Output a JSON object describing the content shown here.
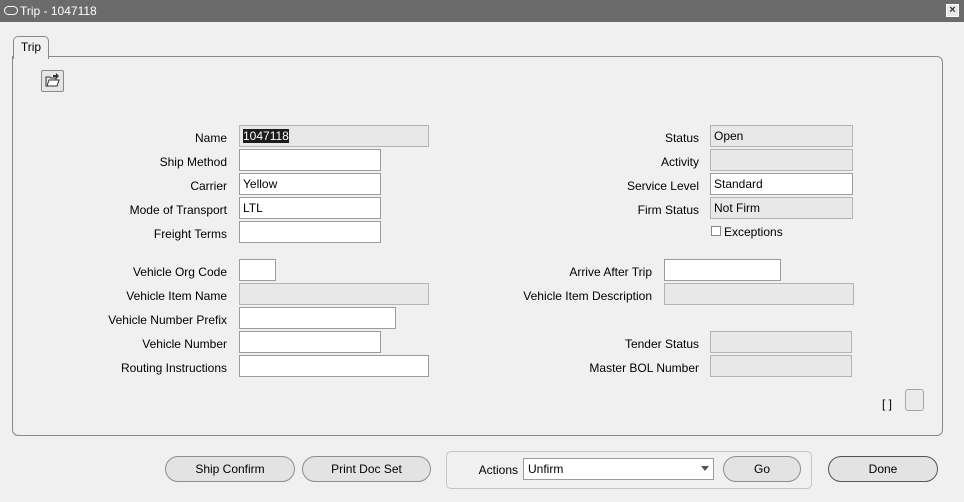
{
  "window": {
    "title": "Trip - 1047118",
    "close_glyph": "×"
  },
  "tab": {
    "label": "Trip"
  },
  "toolbar": {
    "icon": "folder-open-icon"
  },
  "fields": {
    "name": {
      "label": "Name",
      "value": "1047118"
    },
    "ship_method": {
      "label": "Ship Method",
      "value": ""
    },
    "carrier": {
      "label": "Carrier",
      "value": "Yellow"
    },
    "mode_of_transport": {
      "label": "Mode of Transport",
      "value": "LTL"
    },
    "freight_terms": {
      "label": "Freight Terms",
      "value": ""
    },
    "status": {
      "label": "Status",
      "value": "Open"
    },
    "activity": {
      "label": "Activity",
      "value": ""
    },
    "service_level": {
      "label": "Service Level",
      "value": "Standard"
    },
    "firm_status": {
      "label": "Firm Status",
      "value": "Not Firm"
    },
    "exceptions": {
      "label": "Exceptions",
      "checked": false
    },
    "vehicle_org_code": {
      "label": "Vehicle Org Code",
      "value": ""
    },
    "vehicle_item_name": {
      "label": "Vehicle Item Name",
      "value": ""
    },
    "vehicle_number_prefix": {
      "label": "Vehicle Number Prefix",
      "value": ""
    },
    "vehicle_number": {
      "label": "Vehicle Number",
      "value": ""
    },
    "routing_instructions": {
      "label": "Routing Instructions",
      "value": ""
    },
    "arrive_after_trip": {
      "label": "Arrive After Trip",
      "value": ""
    },
    "vehicle_item_description": {
      "label": "Vehicle Item Description",
      "value": ""
    },
    "tender_status": {
      "label": "Tender Status",
      "value": ""
    },
    "master_bol_number": {
      "label": "Master BOL Number",
      "value": ""
    }
  },
  "flex_field": {
    "label": "[ ]"
  },
  "footer": {
    "ship_confirm": "Ship Confirm",
    "print_doc_set": "Print Doc Set",
    "actions_label": "Actions",
    "actions_value": "Unfirm",
    "go": "Go",
    "done": "Done"
  }
}
